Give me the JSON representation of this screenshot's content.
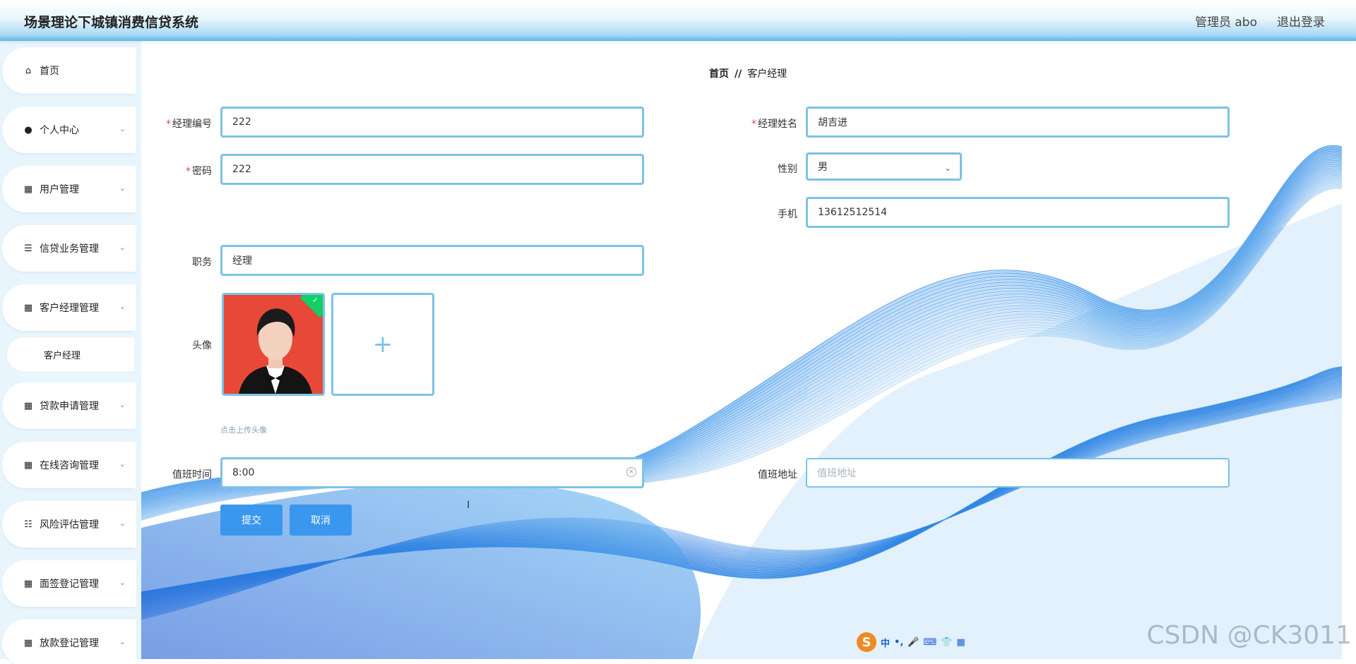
{
  "app": {
    "title": "场景理论下城镇消费信贷系统",
    "admin_label": "管理员 abo",
    "logout": "退出登录"
  },
  "sidebar": {
    "items": [
      {
        "label": "首页",
        "icon": "home-icon",
        "has_chevron": false
      },
      {
        "label": "个人中心",
        "icon": "user-icon",
        "has_chevron": true
      },
      {
        "label": "用户管理",
        "icon": "grid-icon",
        "has_chevron": true
      },
      {
        "label": "信贷业务管理",
        "icon": "list-icon",
        "has_chevron": true
      },
      {
        "label": "客户经理管理",
        "icon": "grid-icon",
        "has_chevron": true
      },
      {
        "label": "贷款申请管理",
        "icon": "grid-icon",
        "has_chevron": true
      },
      {
        "label": "在线咨询管理",
        "icon": "grid-icon",
        "has_chevron": true
      },
      {
        "label": "风险评估管理",
        "icon": "sliders-icon",
        "has_chevron": true
      },
      {
        "label": "面签登记管理",
        "icon": "grid-icon",
        "has_chevron": true
      },
      {
        "label": "放款登记管理",
        "icon": "grid-icon",
        "has_chevron": true
      }
    ],
    "submenu": {
      "label": "客户经理"
    }
  },
  "breadcrumb": {
    "home": "首页",
    "separator": "//",
    "current": "客户经理"
  },
  "form": {
    "manager_id": {
      "label": "经理编号",
      "value": "222",
      "required": true
    },
    "manager_name": {
      "label": "经理姓名",
      "value": "胡吉进",
      "required": true
    },
    "password": {
      "label": "密码",
      "value": "222",
      "required": true
    },
    "gender": {
      "label": "性别",
      "value": "男"
    },
    "phone": {
      "label": "手机",
      "value": "13612512514"
    },
    "position": {
      "label": "职务",
      "value": "经理"
    },
    "avatar": {
      "label": "头像",
      "hint": "点击上传头像"
    },
    "duty_time": {
      "label": "值班时间",
      "value": "8:00"
    },
    "duty_address": {
      "label": "值班地址",
      "value": "",
      "placeholder": "值班地址"
    }
  },
  "buttons": {
    "submit": "提交",
    "cancel": "取消"
  },
  "ime_toolbar": {
    "lang": "中",
    "punct": "•,"
  },
  "watermark": "CSDN @CK3011",
  "colors": {
    "accent": "#3a97ee",
    "field_border": "#7cc2e6",
    "required": "#e54545",
    "header_blue": "#5cb6e6"
  }
}
